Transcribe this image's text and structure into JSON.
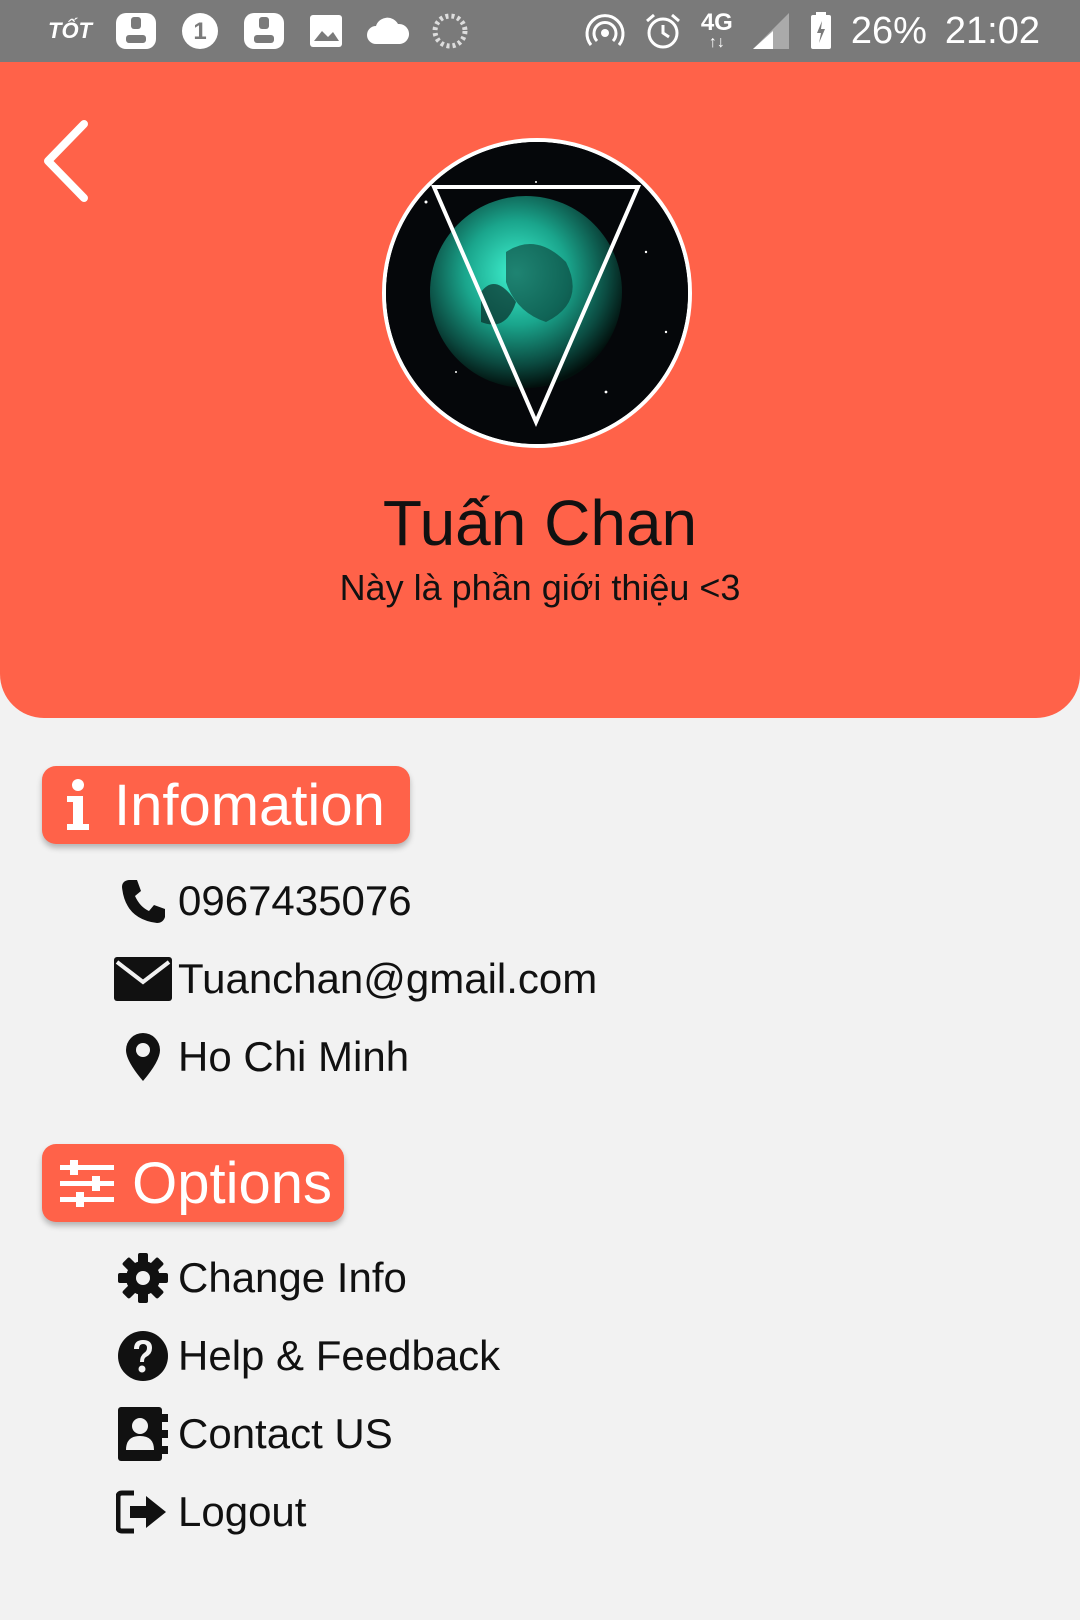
{
  "status_bar": {
    "left_text": "TỐT",
    "notification_count": "1",
    "battery": "26%",
    "time": "21:02",
    "network": "4G"
  },
  "header": {
    "name": "Tuấn Chan",
    "bio": "Này là phần giới thiệu <3"
  },
  "info_section": {
    "title": "Infomation",
    "phone": "0967435076",
    "email": "Tuanchan@gmail.com",
    "location": "Ho Chi Minh"
  },
  "options_section": {
    "title": "Options",
    "items": [
      {
        "label": "Change Info",
        "icon": "gear-icon"
      },
      {
        "label": "Help & Feedback",
        "icon": "question-circle-icon"
      },
      {
        "label": "Contact US",
        "icon": "contact-book-icon"
      },
      {
        "label": "Logout",
        "icon": "logout-icon"
      }
    ]
  },
  "colors": {
    "accent": "#ff6249",
    "background": "#f2f2f2",
    "statusbar": "#7a7a7a",
    "text": "#111111"
  }
}
